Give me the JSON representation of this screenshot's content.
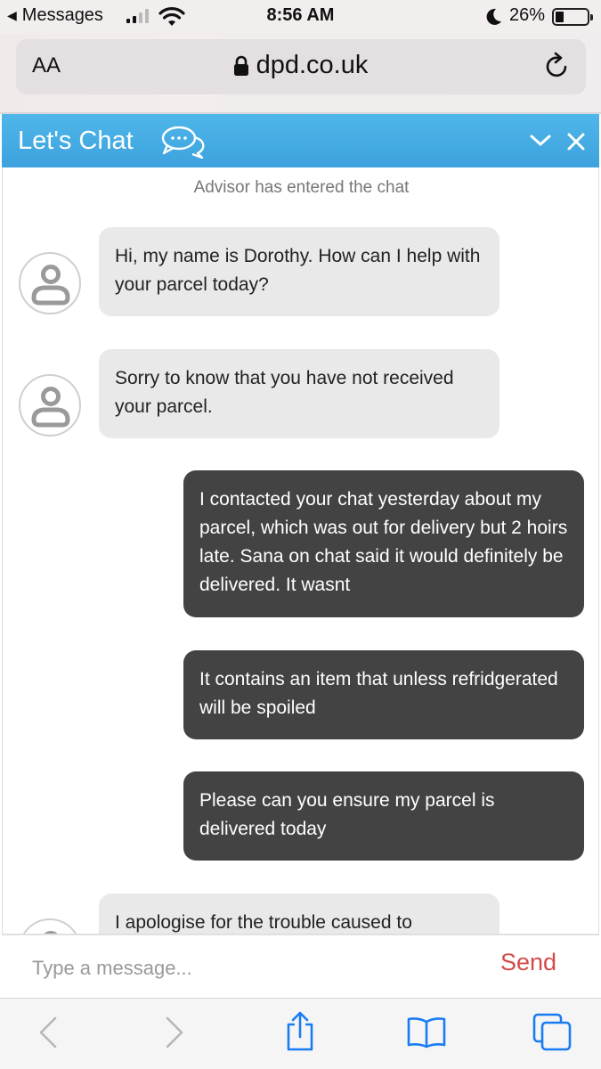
{
  "status_bar": {
    "back_app": "Messages",
    "time": "8:56 AM",
    "battery": "26%"
  },
  "browser": {
    "aa_label": "AA",
    "url": "dpd.co.uk"
  },
  "chat": {
    "title": "Let's Chat",
    "system_message": "Advisor has entered the chat",
    "messages": [
      {
        "from": "agent",
        "text": "Hi, my name is Dorothy. How can I help with your parcel today?"
      },
      {
        "from": "agent",
        "text": "Sorry to know that you have not received your parcel."
      },
      {
        "from": "user",
        "text": "I contacted your chat yesterday about my parcel, which was out for delivery but 2 hoirs late. Sana on chat said it would definitely be delivered. It wasnt"
      },
      {
        "from": "user",
        "text": "It contains an item that unless refridgerated will be spoiled"
      },
      {
        "from": "user",
        "text": "Please can you ensure my parcel is delivered today"
      },
      {
        "from": "agent",
        "text": "I apologise for the trouble caused to"
      }
    ],
    "input_placeholder": "Type a message...",
    "send_label": "Send"
  },
  "colors": {
    "header_blue": "#3da2dd",
    "send_red": "#d44a4a",
    "user_bubble": "#434343",
    "agent_bubble": "#e9e9e9"
  }
}
